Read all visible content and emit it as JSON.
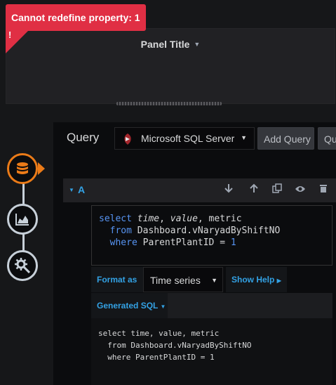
{
  "panel": {
    "title": "Panel Title",
    "error_message": "Cannot redefine property: 1",
    "error_glyph": "!"
  },
  "editor": {
    "heading": "Query",
    "datasource": {
      "name": "Microsoft SQL Server",
      "logo_icon": "sql-server-logo-icon"
    },
    "add_query_label": "Add Query",
    "mixed_label": "Qu",
    "query": {
      "ref_id": "A",
      "raw_sql_lines": [
        "select time, value, metric",
        "  from Dashboard.vNaryadByShiftNO",
        "  where ParentPlantID = 1"
      ],
      "format_as_label": "Format as",
      "format_as_value": "Time series",
      "show_help_label": "Show Help",
      "generated_sql_label": "Generated SQL",
      "generated_sql_lines": [
        "select time, value, metric",
        "  from Dashboard.vNaryadByShiftNO",
        "  where ParentPlantID = 1"
      ]
    }
  },
  "steps": [
    {
      "name": "queries",
      "icon": "database-icon",
      "active": true
    },
    {
      "name": "visualization",
      "icon": "area-chart-icon",
      "active": false
    },
    {
      "name": "general",
      "icon": "gear-icon",
      "active": false
    }
  ],
  "colors": {
    "accent_blue": "#33a2e5",
    "error_red": "#e02f44",
    "active_orange": "#eb7b18"
  }
}
